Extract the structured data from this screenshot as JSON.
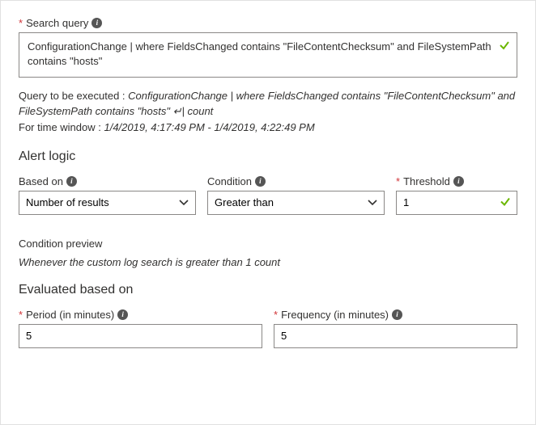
{
  "searchQuery": {
    "label": "Search query",
    "value": "ConfigurationChange | where FieldsChanged contains \"FileContentChecksum\" and FileSystemPath contains \"hosts\""
  },
  "executed": {
    "prefix": "Query to be executed : ",
    "query": "ConfigurationChange | where FieldsChanged contains \"FileContentChecksum\" and FileSystemPath contains \"hosts\" ",
    "suffix": "| count"
  },
  "timeWindow": {
    "prefix": "For time window : ",
    "value": "1/4/2019, 4:17:49 PM - 1/4/2019, 4:22:49 PM"
  },
  "alertLogic": {
    "title": "Alert logic",
    "basedOn": {
      "label": "Based on",
      "value": "Number of results"
    },
    "condition": {
      "label": "Condition",
      "value": "Greater than"
    },
    "threshold": {
      "label": "Threshold",
      "value": "1"
    }
  },
  "conditionPreview": {
    "title": "Condition preview",
    "text": "Whenever the custom log search is greater than 1 count"
  },
  "evaluated": {
    "title": "Evaluated based on",
    "period": {
      "label": "Period (in minutes)",
      "value": "5"
    },
    "frequency": {
      "label": "Frequency (in minutes)",
      "value": "5"
    }
  },
  "glyphs": {
    "required": "*",
    "return": "↵"
  }
}
